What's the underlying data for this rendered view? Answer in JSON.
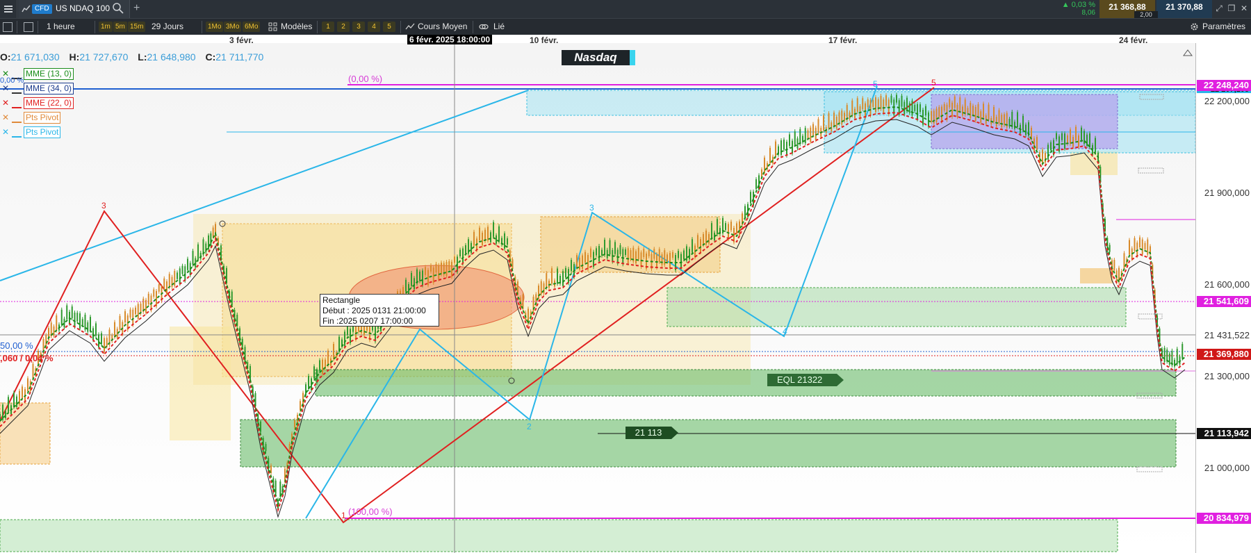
{
  "topbar": {
    "badge": "CFD",
    "instrument": "US NDAQ 100",
    "change_pct": "▲ 0,03 %",
    "change_abs": "8,06",
    "bid": "21 368,88",
    "ask": "21 370,88",
    "spread": "2,00"
  },
  "toolbar": {
    "interval": "1 heure",
    "short_ranges": [
      "1m",
      "5m",
      "15m"
    ],
    "period": "29 Jours",
    "long_ranges": [
      "1Mo",
      "3Mo",
      "6Mo"
    ],
    "models": "Modèles",
    "numbers": [
      "1",
      "2",
      "3",
      "4",
      "5"
    ],
    "cours_moyen": "Cours Moyen",
    "lie": "Lié",
    "parametres": "Paramètres"
  },
  "chart": {
    "dates": {
      "d1": "3 févr.",
      "crosshair": "6 févr. 2025 18:00:00",
      "d2": "10 févr.",
      "d3": "17 févr.",
      "d4": "24 févr."
    },
    "ohlc": {
      "o_label": "O:",
      "o": "21 671,030",
      "h_label": "H:",
      "h": "21 727,670",
      "l_label": "L:",
      "l": "21 648,980",
      "c_label": "C:",
      "c": "21 711,770"
    },
    "banner": "Nasdaq",
    "legend": [
      {
        "name": "MME (13, 0)",
        "color": "#1a8c1a"
      },
      {
        "name": "MME (34, 0)",
        "color": "#1a3a8c"
      },
      {
        "name": "MME (22, 0)",
        "color": "#e02020"
      },
      {
        "name": "Pts Pivot",
        "color": "#e08a3a"
      },
      {
        "name": "Pts Pivot",
        "color": "#2ab6e8"
      }
    ],
    "fib": {
      "top": "(0,00 %)",
      "bottom": "(100,00 %)",
      "mid": "50,00 %",
      "left_top": "0,00 %",
      "left_red": ",060 / 0,04 %"
    },
    "waves": {
      "w3_red": "3",
      "w5_red": "5",
      "w3_cyan": "3",
      "w5_cyan": "5",
      "w2_cyan": "2",
      "w4_cyan": "4",
      "w1_red": "1"
    },
    "tooltip": {
      "title": "Rectangle",
      "start": "Début : 2025 0131 21:00:00",
      "end": "Fin :2025 0207 17:00:00"
    },
    "tags": {
      "eql": "EQL   21322",
      "level": "21 113"
    },
    "price_axis": {
      "labels": [
        "22 200,000",
        "21 900,000",
        "21 600,000",
        "21 431,522",
        "21 300,000",
        "21 000,000"
      ],
      "tag_top": "22 248,240",
      "tag_top_behind": "22 207,108",
      "tag_fib": "21 541,609",
      "tag_last": "21 369,880",
      "tag_level": "21 113,942",
      "tag_bottom": "20 834,979"
    }
  }
}
